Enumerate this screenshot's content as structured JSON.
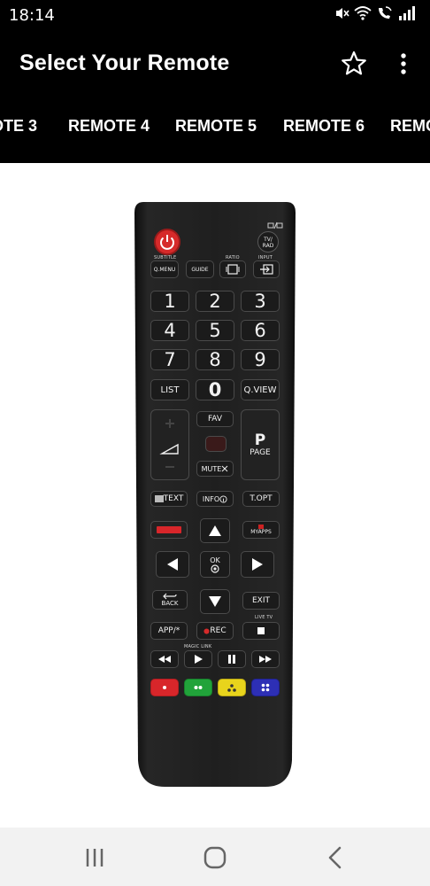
{
  "status_bar": {
    "time": "18:14",
    "icons": [
      "mute-icon",
      "wifi-icon",
      "wifi-calling-icon",
      "signal-icon"
    ]
  },
  "app_bar": {
    "title": "Select Your Remote",
    "star_icon": "star-outline-icon",
    "menu_icon": "more-vert-icon"
  },
  "tabs": [
    "OTE 3",
    "REMOTE 4",
    "REMOTE 5",
    "REMOTE 6",
    "REMO"
  ],
  "remote": {
    "labels": {
      "tv_rad": "TV/\nRAD",
      "subtitle": "SUBTITLE",
      "ratio": "RATIO",
      "input": "INPUT",
      "q_menu": "Q.MENU",
      "guide": "GUIDE",
      "list": "LIST",
      "zero": "0",
      "q_view": "Q.VIEW",
      "fav": "FAV",
      "page_p": "P",
      "page": "PAGE",
      "mute": "MUTE",
      "text": "TEXT",
      "info": "INFO",
      "t_opt": "T.OPT",
      "my_apps": "MYAPPS",
      "ok": "OK",
      "back": "BACK",
      "exit": "EXIT",
      "live_tv": "LIVE TV",
      "app": "APP/*",
      "rec": "REC",
      "magic_link": "MAGIC LINK"
    },
    "numbers": [
      "1",
      "2",
      "3",
      "4",
      "5",
      "6",
      "7",
      "8",
      "9"
    ],
    "colors": {
      "body": "#1d1d1d",
      "power": "#d62a2a",
      "red": "#d8262a",
      "green": "#21a33a",
      "yellow": "#e8d41c",
      "blue": "#2d2fb5"
    }
  },
  "nav_bar": {
    "recents_icon": "recents-icon",
    "home_icon": "home-icon",
    "back_icon": "back-icon"
  }
}
